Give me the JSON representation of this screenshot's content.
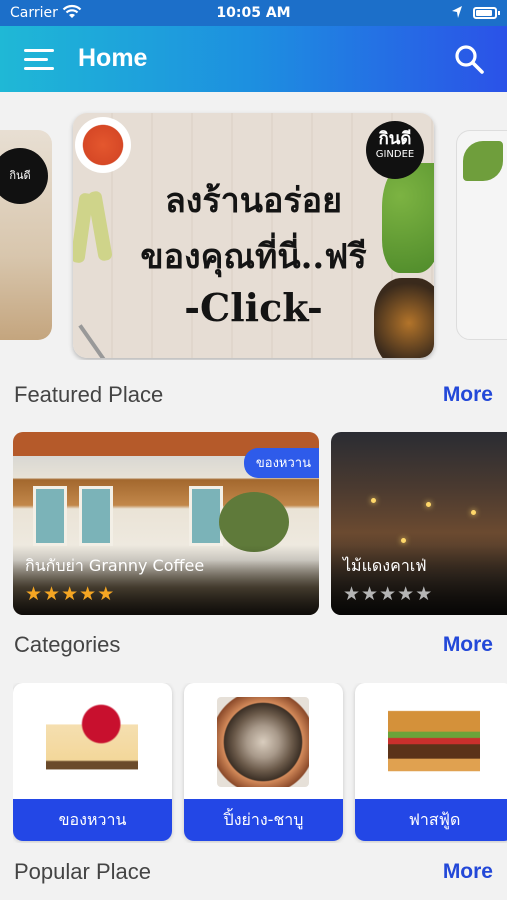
{
  "status_bar": {
    "carrier": "Carrier",
    "time": "10:05 AM"
  },
  "nav": {
    "title": "Home"
  },
  "banner": {
    "logo_th": "กินดี",
    "logo_en": "GINDEE",
    "line1": "ลงร้านอร่อย",
    "line2": "ของคุณที่นี่..ฟรี",
    "line3": "-Click-",
    "left_logo_th": "กินดี",
    "left_logo_en": "GINDEE"
  },
  "featured": {
    "title": "Featured Place",
    "more": "More",
    "places": [
      {
        "name": "กินกับย่า Granny Coffee",
        "tag": "ของหวาน",
        "rating": 5
      },
      {
        "name": "ไม้แดงคาเฟ่",
        "rating": 0
      }
    ]
  },
  "categories": {
    "title": "Categories",
    "more": "More",
    "items": [
      {
        "label": "ของหวาน"
      },
      {
        "label": "ปิ้งย่าง-ชาบู"
      },
      {
        "label": "ฟาสฟู้ด"
      }
    ]
  },
  "popular": {
    "title": "Popular Place",
    "more": "More"
  },
  "colors": {
    "accent": "#2347e6",
    "more_link": "#2348d8",
    "star_on": "#f5a623",
    "star_off": "#b5b5b5"
  }
}
